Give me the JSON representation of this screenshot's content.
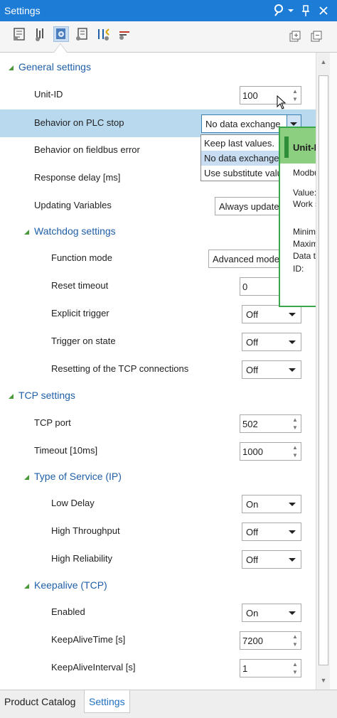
{
  "window": {
    "title": "Settings",
    "icons": [
      "search-person-icon",
      "dropdown-arrow-icon",
      "pin-icon",
      "close-icon"
    ]
  },
  "toolbar": {
    "icons": [
      "device-settings-icon",
      "io-settings-icon",
      "gear-settings-icon",
      "parameter-icon",
      "network-icon",
      "connection-settings-icon"
    ],
    "right_icons": [
      "expand-all-icon",
      "collapse-all-icon"
    ]
  },
  "general": {
    "title": "General settings",
    "unit_id": {
      "label": "Unit-ID",
      "value": "100"
    },
    "plc_stop": {
      "label": "Behavior on PLC stop",
      "value": "No data exchange"
    },
    "fieldbus_error": {
      "label": "Behavior on fieldbus error"
    },
    "response_delay": {
      "label": "Response delay [ms]"
    },
    "updating_vars": {
      "label": "Updating Variables",
      "value": "Always update"
    }
  },
  "dropdown": {
    "options": [
      "Keep last values.",
      "No data exchange",
      "Use substitute values"
    ]
  },
  "watchdog": {
    "title": "Watchdog settings",
    "function_mode": {
      "label": "Function mode",
      "value": "Advanced mode"
    },
    "reset_timeout": {
      "label": "Reset timeout",
      "value": "0"
    },
    "explicit_trigger": {
      "label": "Explicit trigger",
      "value": "Off"
    },
    "trigger_on_state": {
      "label": "Trigger on state",
      "value": "Off"
    },
    "resetting_tcp": {
      "label": "Resetting of the TCP connections",
      "value": "Off"
    }
  },
  "tcp": {
    "title": "TCP settings",
    "port": {
      "label": "TCP port",
      "value": "502"
    },
    "timeout": {
      "label": "Timeout [10ms]",
      "value": "1000"
    }
  },
  "tos": {
    "title": "Type of Service (IP)",
    "low_delay": {
      "label": "Low Delay",
      "value": "On"
    },
    "high_throughput": {
      "label": "High Throughput",
      "value": "Off"
    },
    "high_reliability": {
      "label": "High Reliability",
      "value": "Off"
    }
  },
  "keepalive": {
    "title": "Keepalive (TCP)",
    "enabled": {
      "label": "Enabled",
      "value": "On"
    },
    "time": {
      "label": "KeepAliveTime [s]",
      "value": "7200"
    },
    "interval": {
      "label": "KeepAliveInterval [s]",
      "value": "1"
    }
  },
  "tooltip": {
    "title": "Unit-ID",
    "description": "Modbus un",
    "value_label": "Value:",
    "value_text": "Work settin",
    "minimum": "Minimum:",
    "maximum": "Maximum:",
    "data_type": "Data type:",
    "id": "ID:"
  },
  "tabs": {
    "product_catalog": "Product Catalog",
    "settings": "Settings"
  },
  "colors": {
    "title_bar": "#1c7cd6",
    "row_highlight": "#b9d9ef",
    "section_text": "#1f5fa8",
    "tooltip_border": "#3aa64a"
  }
}
